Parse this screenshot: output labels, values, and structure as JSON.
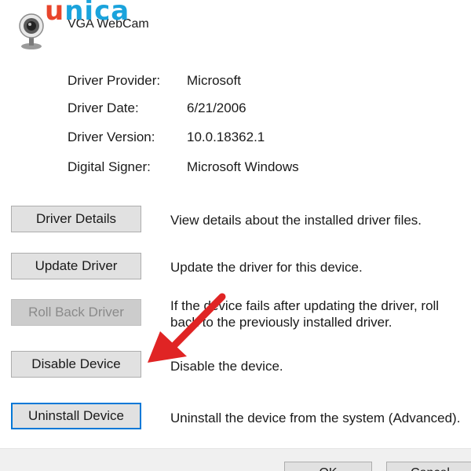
{
  "branding": {
    "logo_text": "unica"
  },
  "device": {
    "name": "VGA WebCam",
    "icon": "webcam-icon"
  },
  "properties": [
    {
      "label": "Driver Provider:",
      "value": "Microsoft"
    },
    {
      "label": "Driver Date:",
      "value": "6/21/2006"
    },
    {
      "label": "Driver Version:",
      "value": "10.0.18362.1"
    },
    {
      "label": "Digital Signer:",
      "value": "Microsoft Windows"
    }
  ],
  "actions": [
    {
      "label": "Driver Details",
      "description": "View details about the installed driver files.",
      "enabled": true
    },
    {
      "label": "Update Driver",
      "description": "Update the driver for this device.",
      "enabled": true
    },
    {
      "label": "Roll Back Driver",
      "description": "If the device fails after updating the driver, roll back to the previously installed driver.",
      "enabled": false
    },
    {
      "label": "Disable Device",
      "description": "Disable the device.",
      "enabled": true
    },
    {
      "label": "Uninstall Device",
      "description": "Uninstall the device from the system (Advanced).",
      "enabled": true
    }
  ],
  "footer": {
    "ok_label": "OK",
    "cancel_label": "Cancel"
  },
  "colors": {
    "focus_border": "#0078d7",
    "annotation_arrow": "#e02424"
  }
}
